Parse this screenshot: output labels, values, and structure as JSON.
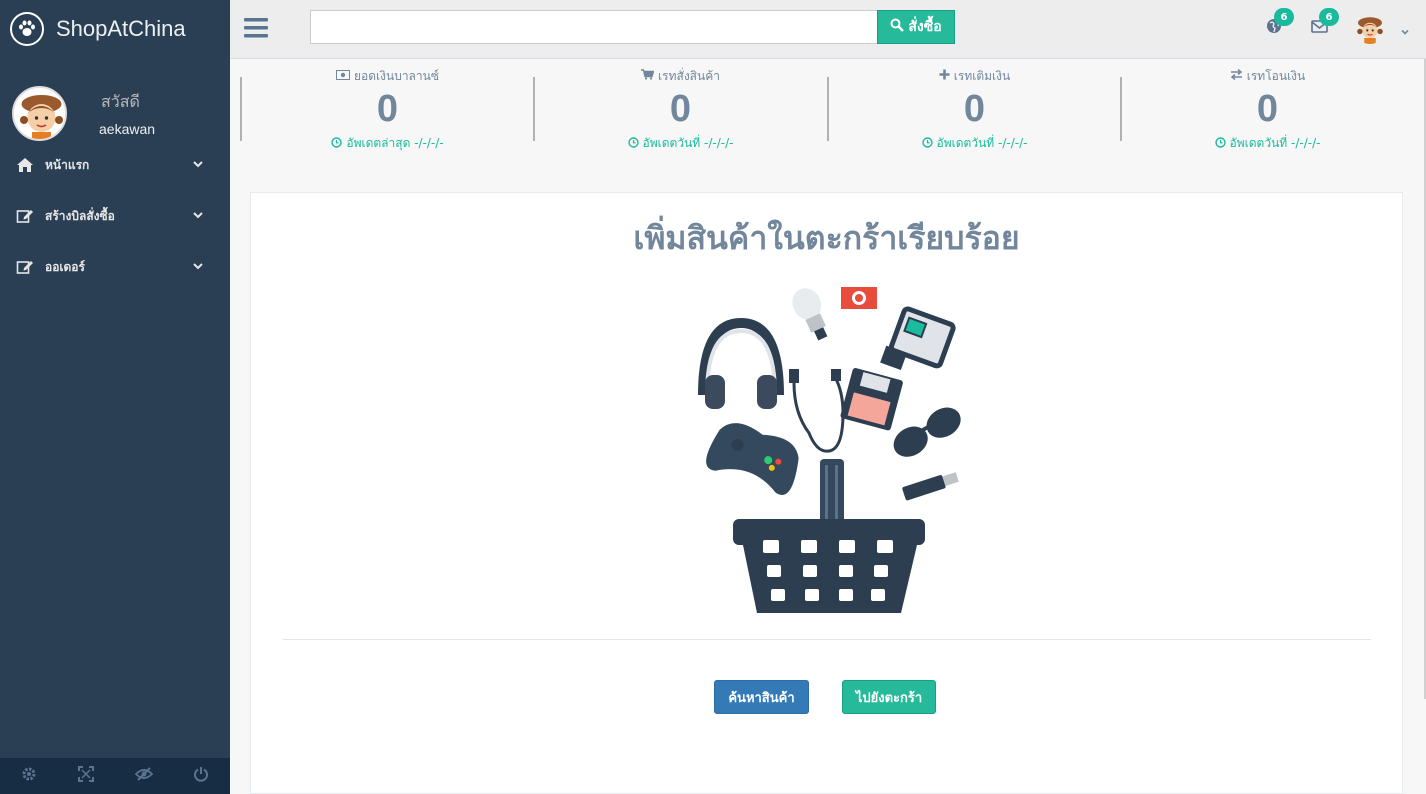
{
  "brand": {
    "name": "ShopAtChina",
    "logo_icon": "paw-icon"
  },
  "profile": {
    "welcome": "สวัสดี",
    "username": "aekawan"
  },
  "sidebar": {
    "items": [
      {
        "label": "หน้าแรก",
        "icon": "home-icon"
      },
      {
        "label": "สร้างบิลสั่งซื้อ",
        "icon": "edit-icon"
      },
      {
        "label": "ออเดอร์",
        "icon": "edit-icon"
      }
    ],
    "footer_icons": [
      "gear-icon",
      "fullscreen-icon",
      "eye-slash-icon",
      "power-icon"
    ]
  },
  "topnav": {
    "search_placeholder": "",
    "search_button": "สั่งซื้อ",
    "notification_badge": "6",
    "mail_badge": "6"
  },
  "stats": [
    {
      "label": "ยอดเงินบาลานซ์",
      "icon": "money-icon",
      "value": "0",
      "footer": "อัพเดตล่าสุด -/-/-/-"
    },
    {
      "label": "เรทสั่งสินค้า",
      "icon": "cart-icon",
      "value": "0",
      "footer": "อัพเดตวันที่ -/-/-/-"
    },
    {
      "label": "เรทเติมเงิน",
      "icon": "plus-icon",
      "value": "0",
      "footer": "อัพเดตวันที่ -/-/-/-"
    },
    {
      "label": "เรทโอนเงิน",
      "icon": "exchange-icon",
      "value": "0",
      "footer": "อัพเดตวันที่ -/-/-/-"
    }
  ],
  "panel": {
    "title": "เพิ่มสินค้าในตะกร้าเรียบร้อย",
    "search_button": "ค้นหาสินค้า",
    "cart_button": "ไปยังตะกร้า"
  },
  "colors": {
    "sidebar": "#2a3f54",
    "sidebar_footer": "#172d44",
    "accent_green": "#26b99a",
    "primary_blue": "#337ab7",
    "text_gray": "#73879c"
  }
}
